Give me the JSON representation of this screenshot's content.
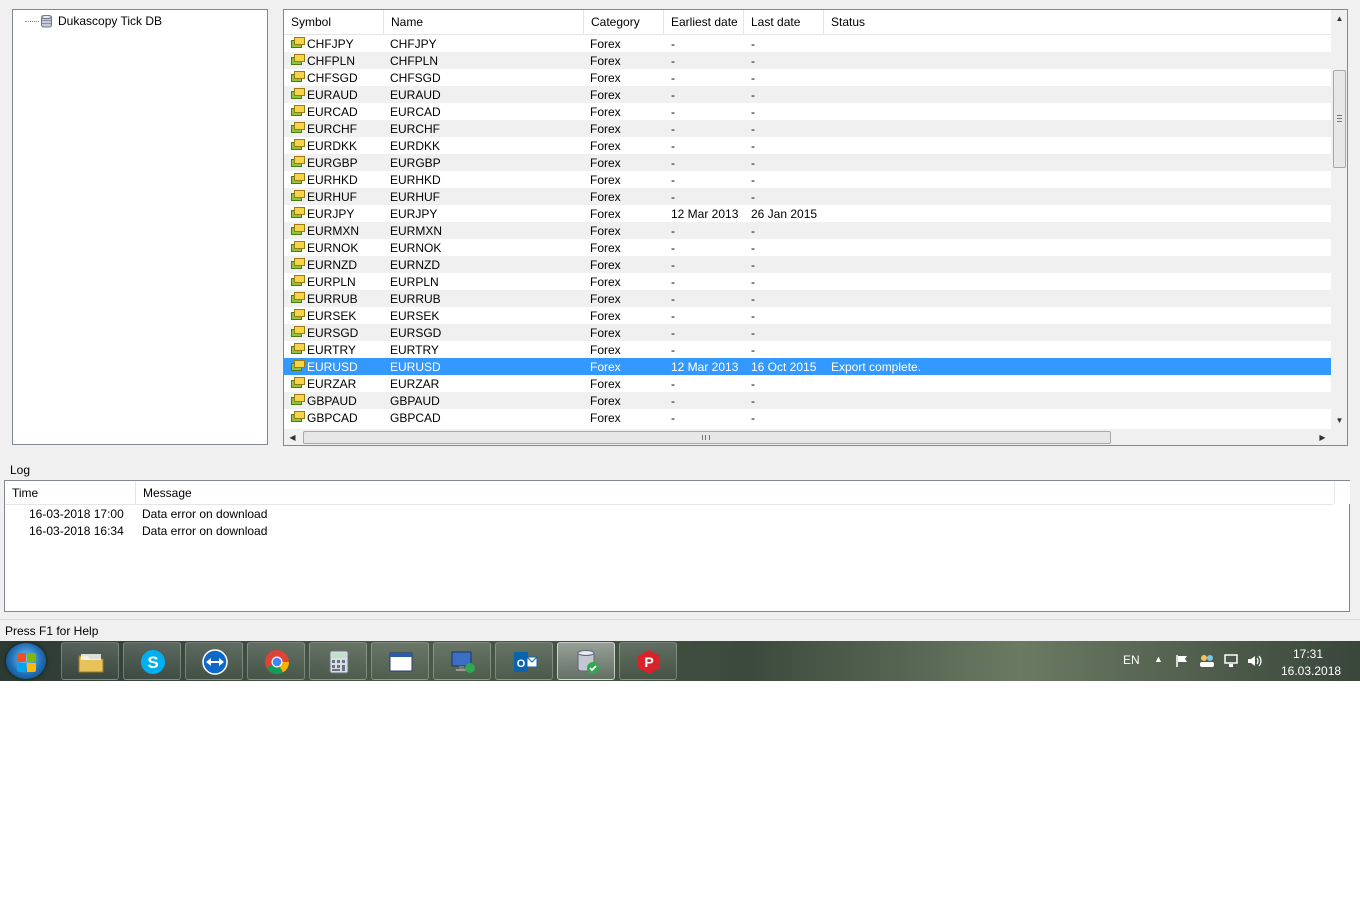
{
  "tree": {
    "root_label": "Dukascopy Tick DB"
  },
  "symbols": {
    "columns": [
      "Symbol",
      "Name",
      "Category",
      "Earliest date",
      "Last date",
      "Status"
    ],
    "rows": [
      {
        "symbol": "CHFJPY",
        "name": "CHFJPY",
        "category": "Forex",
        "earliest": "-",
        "last": "-",
        "status": ""
      },
      {
        "symbol": "CHFPLN",
        "name": "CHFPLN",
        "category": "Forex",
        "earliest": "-",
        "last": "-",
        "status": ""
      },
      {
        "symbol": "CHFSGD",
        "name": "CHFSGD",
        "category": "Forex",
        "earliest": "-",
        "last": "-",
        "status": ""
      },
      {
        "symbol": "EURAUD",
        "name": "EURAUD",
        "category": "Forex",
        "earliest": "-",
        "last": "-",
        "status": ""
      },
      {
        "symbol": "EURCAD",
        "name": "EURCAD",
        "category": "Forex",
        "earliest": "-",
        "last": "-",
        "status": ""
      },
      {
        "symbol": "EURCHF",
        "name": "EURCHF",
        "category": "Forex",
        "earliest": "-",
        "last": "-",
        "status": ""
      },
      {
        "symbol": "EURDKK",
        "name": "EURDKK",
        "category": "Forex",
        "earliest": "-",
        "last": "-",
        "status": ""
      },
      {
        "symbol": "EURGBP",
        "name": "EURGBP",
        "category": "Forex",
        "earliest": "-",
        "last": "-",
        "status": ""
      },
      {
        "symbol": "EURHKD",
        "name": "EURHKD",
        "category": "Forex",
        "earliest": "-",
        "last": "-",
        "status": ""
      },
      {
        "symbol": "EURHUF",
        "name": "EURHUF",
        "category": "Forex",
        "earliest": "-",
        "last": "-",
        "status": ""
      },
      {
        "symbol": "EURJPY",
        "name": "EURJPY",
        "category": "Forex",
        "earliest": "12 Mar 2013",
        "last": "26 Jan 2015",
        "status": ""
      },
      {
        "symbol": "EURMXN",
        "name": "EURMXN",
        "category": "Forex",
        "earliest": "-",
        "last": "-",
        "status": ""
      },
      {
        "symbol": "EURNOK",
        "name": "EURNOK",
        "category": "Forex",
        "earliest": "-",
        "last": "-",
        "status": ""
      },
      {
        "symbol": "EURNZD",
        "name": "EURNZD",
        "category": "Forex",
        "earliest": "-",
        "last": "-",
        "status": ""
      },
      {
        "symbol": "EURPLN",
        "name": "EURPLN",
        "category": "Forex",
        "earliest": "-",
        "last": "-",
        "status": ""
      },
      {
        "symbol": "EURRUB",
        "name": "EURRUB",
        "category": "Forex",
        "earliest": "-",
        "last": "-",
        "status": ""
      },
      {
        "symbol": "EURSEK",
        "name": "EURSEK",
        "category": "Forex",
        "earliest": "-",
        "last": "-",
        "status": ""
      },
      {
        "symbol": "EURSGD",
        "name": "EURSGD",
        "category": "Forex",
        "earliest": "-",
        "last": "-",
        "status": ""
      },
      {
        "symbol": "EURTRY",
        "name": "EURTRY",
        "category": "Forex",
        "earliest": "-",
        "last": "-",
        "status": ""
      },
      {
        "symbol": "EURUSD",
        "name": "EURUSD",
        "category": "Forex",
        "earliest": "12 Mar 2013",
        "last": "16 Oct 2015",
        "status": "Export complete.",
        "selected": true
      },
      {
        "symbol": "EURZAR",
        "name": "EURZAR",
        "category": "Forex",
        "earliest": "-",
        "last": "-",
        "status": ""
      },
      {
        "symbol": "GBPAUD",
        "name": "GBPAUD",
        "category": "Forex",
        "earliest": "-",
        "last": "-",
        "status": ""
      },
      {
        "symbol": "GBPCAD",
        "name": "GBPCAD",
        "category": "Forex",
        "earliest": "-",
        "last": "-",
        "status": ""
      }
    ]
  },
  "log": {
    "label": "Log",
    "columns": [
      "Time",
      "Message"
    ],
    "rows": [
      {
        "time": "16-03-2018 17:00",
        "message": "Data error on download"
      },
      {
        "time": "16-03-2018 16:34",
        "message": "Data error on download"
      }
    ]
  },
  "statusbar": {
    "text": "Press F1 for Help"
  },
  "taskbar": {
    "apps": [
      {
        "name": "file-explorer",
        "icon": "folder-icon"
      },
      {
        "name": "skype",
        "icon": "skype-icon"
      },
      {
        "name": "teamviewer",
        "icon": "teamviewer-icon"
      },
      {
        "name": "chrome",
        "icon": "chrome-icon"
      },
      {
        "name": "calculator",
        "icon": "calculator-icon"
      },
      {
        "name": "window",
        "icon": "window-icon"
      },
      {
        "name": "remote-desktop",
        "icon": "remote-desktop-icon"
      },
      {
        "name": "outlook",
        "icon": "outlook-icon"
      },
      {
        "name": "tick-db",
        "icon": "database-icon",
        "active": true
      },
      {
        "name": "pushbullet",
        "icon": "p-app-icon"
      }
    ],
    "language": "EN",
    "time": "17:31",
    "date": "16.03.2018"
  },
  "colors": {
    "selection": "#3399ff",
    "alt_row": "#f0f0f0"
  }
}
